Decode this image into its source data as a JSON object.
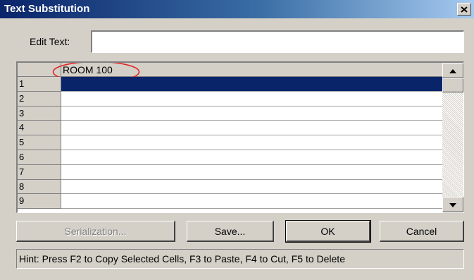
{
  "window": {
    "title": "Text Substitution",
    "close_label": "close"
  },
  "edit": {
    "label": "Edit Text:",
    "value": "",
    "placeholder": ""
  },
  "grid": {
    "column_header": "ROOM 100",
    "rows": [
      {
        "num": "1",
        "value": "",
        "selected": true
      },
      {
        "num": "2",
        "value": ""
      },
      {
        "num": "3",
        "value": ""
      },
      {
        "num": "4",
        "value": ""
      },
      {
        "num": "5",
        "value": ""
      },
      {
        "num": "6",
        "value": ""
      },
      {
        "num": "7",
        "value": ""
      },
      {
        "num": "8",
        "value": ""
      },
      {
        "num": "9",
        "value": ""
      }
    ]
  },
  "buttons": {
    "serialization": "Serialization...",
    "save": "Save...",
    "ok": "OK",
    "cancel": "Cancel"
  },
  "hint": "Hint: Press F2 to Copy Selected Cells, F3 to Paste, F4 to Cut, F5 to Delete",
  "colors": {
    "selection": "#0a246a",
    "annotation": "#e02020",
    "face": "#d4d0c8"
  }
}
